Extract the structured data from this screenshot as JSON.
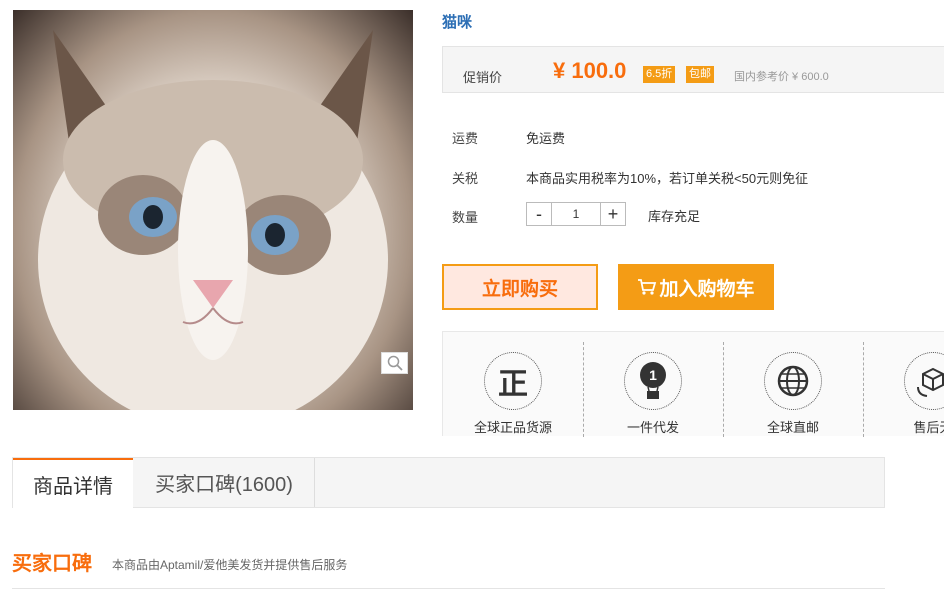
{
  "product": {
    "title": "猫咪",
    "image_icon": "cat-photo",
    "zoom_icon": "magnifier-icon"
  },
  "price": {
    "promo_label": "促销价",
    "price": "¥ 100.0",
    "discount_tag": "6.5折",
    "free_ship_tag": "包邮",
    "reference": "国内参考价 ¥ 600.0"
  },
  "details": {
    "shipping_label": "运费",
    "shipping_value": "免运费",
    "tax_label": "关税",
    "tax_value": "本商品实用税率为10%，若订单关税<50元则免征",
    "qty_label": "数量",
    "qty_minus": "-",
    "qty_value": "1",
    "qty_plus": "+",
    "stock": "库存充足"
  },
  "actions": {
    "buy_now": "立即购买",
    "add_cart": "加入购物车"
  },
  "features": [
    {
      "label": "全球正品货源",
      "icon": "genuine-icon",
      "glyph": "正"
    },
    {
      "label": "一件代发",
      "icon": "balloon-icon",
      "glyph": "1"
    },
    {
      "label": "全球直邮",
      "icon": "globe-icon",
      "glyph": ""
    },
    {
      "label": "售后无",
      "icon": "box-icon",
      "glyph": ""
    }
  ],
  "tabs": [
    {
      "label": "商品详情"
    },
    {
      "label": "买家口碑(1600)"
    }
  ],
  "reviews": {
    "title": "买家口碑",
    "subtitle": "本商品由Aptamil/爱他美发货并提供售后服务"
  },
  "colors": {
    "accent": "#f86d0d",
    "tag": "#f49c15",
    "title": "#2d6fb5"
  }
}
